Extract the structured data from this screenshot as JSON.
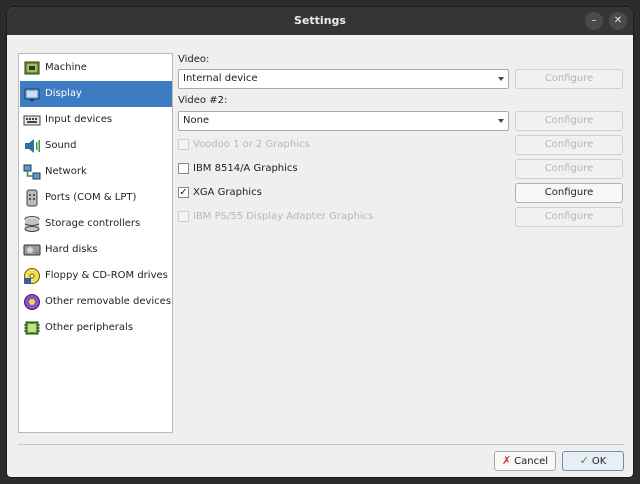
{
  "window": {
    "title": "Settings"
  },
  "sidebar": {
    "items": [
      {
        "label": "Machine",
        "icon": "machine-icon"
      },
      {
        "label": "Display",
        "icon": "display-icon"
      },
      {
        "label": "Input devices",
        "icon": "keyboard-icon"
      },
      {
        "label": "Sound",
        "icon": "speaker-icon"
      },
      {
        "label": "Network",
        "icon": "network-icon"
      },
      {
        "label": "Ports (COM & LPT)",
        "icon": "port-icon"
      },
      {
        "label": "Storage controllers",
        "icon": "storage-icon"
      },
      {
        "label": "Hard disks",
        "icon": "hard-disk-icon"
      },
      {
        "label": "Floppy & CD-ROM drives",
        "icon": "floppy-cd-icon"
      },
      {
        "label": "Other removable devices",
        "icon": "removable-icon"
      },
      {
        "label": "Other peripherals",
        "icon": "chip-icon"
      }
    ],
    "selected": "Display"
  },
  "video": {
    "label": "Video:",
    "value": "Internal device",
    "configure": "Configure"
  },
  "video2": {
    "label": "Video #2:",
    "value": "None",
    "configure": "Configure"
  },
  "options": [
    {
      "label": "Voodoo 1 or 2 Graphics",
      "checked": false,
      "enabled": false,
      "configure": "Configure",
      "configure_enabled": false
    },
    {
      "label": "IBM 8514/A Graphics",
      "checked": false,
      "enabled": true,
      "configure": "Configure",
      "configure_enabled": false
    },
    {
      "label": "XGA Graphics",
      "checked": true,
      "enabled": true,
      "configure": "Configure",
      "configure_enabled": true
    },
    {
      "label": "IBM PS/55 Display Adapter Graphics",
      "checked": false,
      "enabled": false,
      "configure": "Configure",
      "configure_enabled": false
    }
  ],
  "buttons": {
    "cancel": "Cancel",
    "ok": "OK"
  },
  "colors": {
    "selection": "#3d7bc3",
    "titlebar": "#353535"
  }
}
